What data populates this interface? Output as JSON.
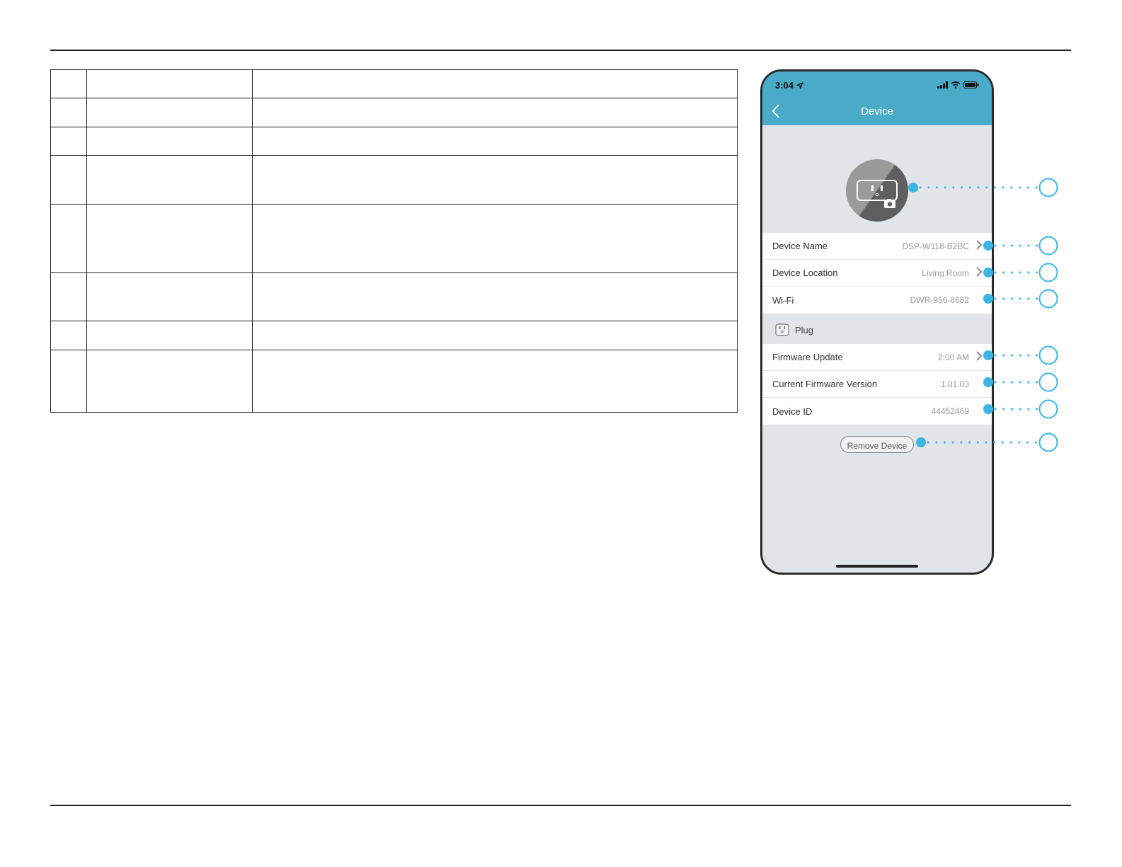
{
  "phone": {
    "status_time": "3:04",
    "nav_title": "Device",
    "rows_group1": [
      {
        "label": "Device Name",
        "value": "DSP-W118-B2BC",
        "chevron": true
      },
      {
        "label": "Device Location",
        "value": "Living Room",
        "chevron": true
      },
      {
        "label": "Wi-Fi",
        "value": "DWR-956-8682",
        "chevron": false
      }
    ],
    "section_label": "Plug",
    "rows_group2": [
      {
        "label": "Firmware Update",
        "value": "2:00 AM",
        "chevron": true
      },
      {
        "label": "Current Firmware Version",
        "value": "1.01.03",
        "chevron": false
      },
      {
        "label": "Device ID",
        "value": "44452469",
        "chevron": false
      }
    ],
    "remove_button_label": "Remove Device"
  },
  "colors": {
    "header_bar": "#4aabc9",
    "callout": "#3bb6e3",
    "screen_background": "#e1e4e8"
  },
  "icons": {
    "back": "chevron-left-icon",
    "chevron": "chevron-right-icon",
    "plug": "plug-icon",
    "camera": "camera-icon",
    "wifi": "wifi-icon",
    "battery": "battery-icon",
    "location": "location-arrow-icon"
  }
}
